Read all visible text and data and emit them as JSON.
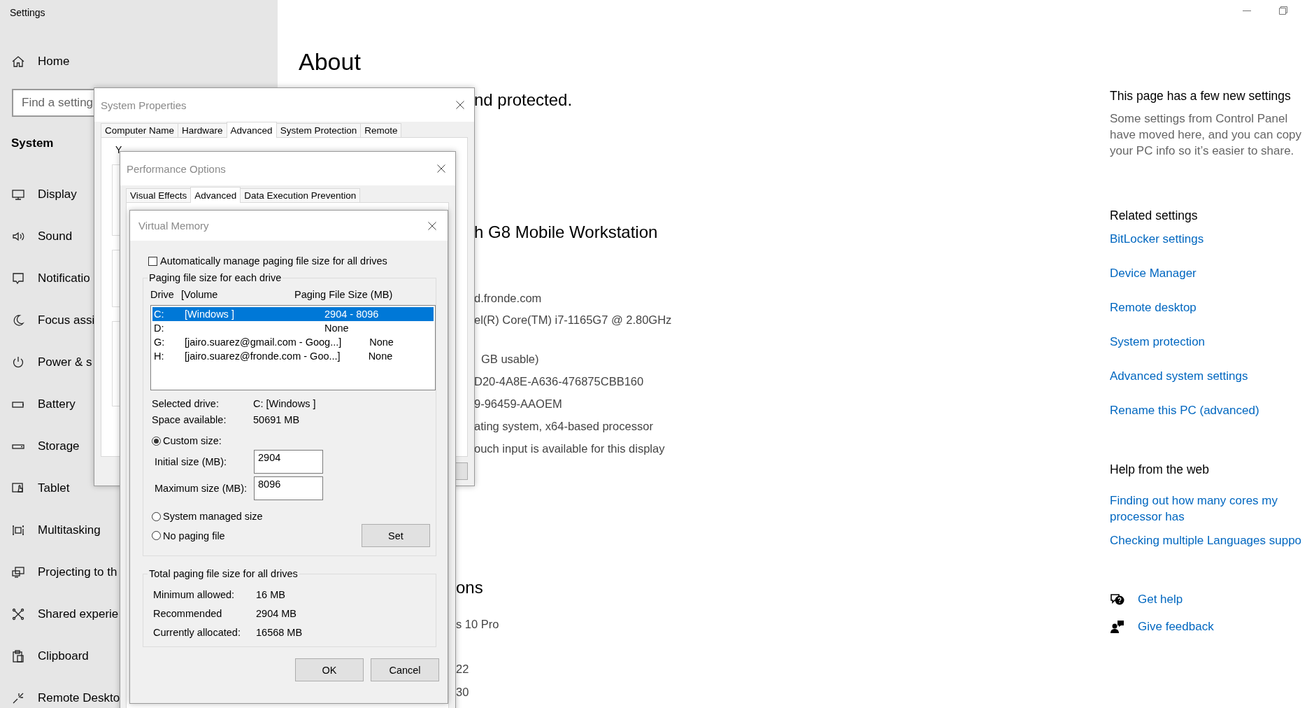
{
  "window": {
    "title": "Settings"
  },
  "sidebar": {
    "home": "Home",
    "search": {
      "placeholder": "Find a setting"
    },
    "section": "System",
    "items": [
      {
        "label": "Display",
        "kind": "display"
      },
      {
        "label": "Sound",
        "kind": "sound"
      },
      {
        "label": "Notificatio",
        "kind": "notifications"
      },
      {
        "label": "Focus assi",
        "kind": "focus"
      },
      {
        "label": "Power & s",
        "kind": "power"
      },
      {
        "label": "Battery",
        "kind": "battery"
      },
      {
        "label": "Storage",
        "kind": "storage"
      },
      {
        "label": "Tablet",
        "kind": "tablet"
      },
      {
        "label": "Multitasking",
        "kind": "multitasking"
      },
      {
        "label": "Projecting to th",
        "kind": "projecting"
      },
      {
        "label": "Shared experie",
        "kind": "shared"
      },
      {
        "label": "Clipboard",
        "kind": "clipboard"
      },
      {
        "label": "Remote Deskto",
        "kind": "remote"
      }
    ]
  },
  "main": {
    "title": "About",
    "fragments": [
      {
        "text": "nd protected.",
        "kind": "heading"
      },
      {
        "text": "h G8 Mobile Workstation",
        "kind": "heading"
      },
      {
        "text": "d.fronde.com",
        "kind": "line"
      },
      {
        "text": "el(R) Core(TM) i7-1165G7 @ 2.80GHz",
        "kind": "line"
      },
      {
        "text": "GB usable)",
        "kind": "line"
      },
      {
        "text": "D20-4A8E-A636-476875CBB160",
        "kind": "line"
      },
      {
        "text": "9-96459-AAOEM",
        "kind": "line"
      },
      {
        "text": "ating system, x64-based processor",
        "kind": "line"
      },
      {
        "text": "ouch input is available for this display",
        "kind": "line"
      },
      {
        "text": "ons",
        "kind": "heading"
      },
      {
        "text": "s 10 Pro",
        "kind": "line"
      },
      {
        "text": "22",
        "kind": "line"
      },
      {
        "text": "30",
        "kind": "line"
      }
    ]
  },
  "aside": {
    "new_settings": {
      "title": "This page has a few new settings",
      "text": "Some settings from Control Panel have moved here, and you can copy your PC info so it’s easier to share."
    },
    "related": {
      "title": "Related settings",
      "links": [
        "BitLocker settings",
        "Device Manager",
        "Remote desktop",
        "System protection",
        "Advanced system settings",
        "Rename this PC (advanced)"
      ]
    },
    "help_web": {
      "title": "Help from the web",
      "links": [
        "Finding out how many cores my processor has",
        "Checking multiple Languages suppo"
      ]
    },
    "support": [
      {
        "label": "Get help",
        "kind": "help"
      },
      {
        "label": "Give feedback",
        "kind": "feedback"
      }
    ]
  },
  "system_properties": {
    "title": "System Properties",
    "tabs": [
      {
        "label": "Computer Name",
        "selected": false
      },
      {
        "label": "Hardware",
        "selected": false
      },
      {
        "label": "Advanced",
        "selected": true
      },
      {
        "label": "System Protection",
        "selected": false
      },
      {
        "label": "Remote",
        "selected": false
      }
    ],
    "fragments": [
      "Y"
    ]
  },
  "performance_options": {
    "title": "Performance Options",
    "tabs": [
      {
        "label": "Visual Effects",
        "selected": false
      },
      {
        "label": "Advanced",
        "selected": true
      },
      {
        "label": "Data Execution Prevention",
        "selected": false
      }
    ]
  },
  "virtual_memory": {
    "title": "Virtual Memory",
    "auto_manage": {
      "label": "Automatically manage paging file size for all drives",
      "checked": false
    },
    "drives_group": "Paging file size for each drive",
    "columns": [
      "Drive",
      "[Volume",
      "Paging File Size (MB)"
    ],
    "drives": [
      {
        "drive": "C:",
        "volume": "[Windows ]",
        "size": "2904 - 8096",
        "selected": true
      },
      {
        "drive": "D:",
        "size": "None",
        "selected": false
      },
      {
        "drive": "G:",
        "volume": "[jairo.suarez@gmail.com - Goog...]",
        "size": "None",
        "selected": false
      },
      {
        "drive": "H:",
        "volume": "[jairo.suarez@fronde.com - Goo...]",
        "size": "None",
        "selected": false
      }
    ],
    "info": [
      {
        "label": "Selected drive:",
        "value": "C:  [Windows ]"
      },
      {
        "label": "Space available:",
        "value": "50691 MB"
      }
    ],
    "size_modes": [
      {
        "label": "Custom size:",
        "selected": true
      },
      {
        "label": "System managed size",
        "selected": false
      },
      {
        "label": "No paging file",
        "selected": false
      }
    ],
    "initial_size": {
      "label": "Initial size (MB):",
      "value": "2904"
    },
    "maximum_size": {
      "label": "Maximum size (MB):",
      "value": "8096"
    },
    "set_button": "Set",
    "totals": {
      "title": "Total paging file size for all drives",
      "rows": [
        {
          "label": "Minimum allowed:",
          "value": "16 MB"
        },
        {
          "label": "Recommended",
          "value": "2904 MB"
        },
        {
          "label": "Currently allocated:",
          "value": "16568 MB"
        }
      ]
    },
    "buttons": [
      "OK",
      "Cancel"
    ]
  }
}
